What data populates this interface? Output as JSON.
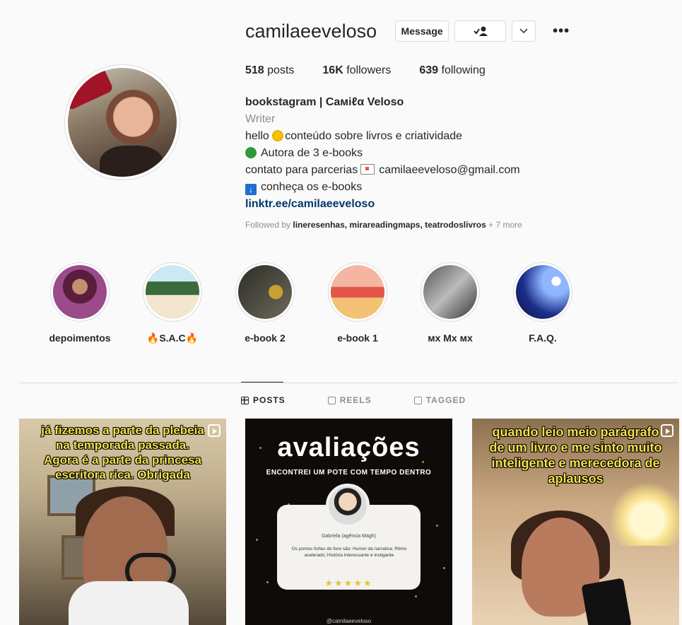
{
  "profile": {
    "username": "camilaeeveloso",
    "actions": {
      "message": "Message",
      "follow_icon": "person-check-icon",
      "chevron_icon": "chevron-down-icon",
      "more": "•••"
    },
    "stats": {
      "posts_count": "518",
      "posts_label": "posts",
      "followers_count": "16K",
      "followers_label": "followers",
      "following_count": "639",
      "following_label": "following"
    },
    "bio": {
      "name": "bookstagram | Cамiℓα Veloso",
      "category": "Writer",
      "line1": "hello ",
      "line1b": "conteúdo sobre livros e criatividade",
      "line2": "Autora de 3 e-books",
      "line3a": "contato para parcerias",
      "line3b": "camilaeeveloso@gmail.com",
      "line4": "conheça os e-books",
      "link": "linktr.ee/camilaeeveloso"
    },
    "followed_by": {
      "prefix": "Followed by ",
      "names": "lineresenhas, mirareadingmaps, teatrodoslivros",
      "suffix": " + 7 more"
    }
  },
  "highlights": [
    {
      "label": "depoimentos"
    },
    {
      "label": "🔥S.A.C🔥"
    },
    {
      "label": "e-book 2"
    },
    {
      "label": "e-book 1"
    },
    {
      "label": "ᴍx Mx ᴍx"
    },
    {
      "label": "F.A.Q."
    }
  ],
  "tabs": [
    {
      "label": "POSTS",
      "icon": "grid-icon"
    },
    {
      "label": "REELS",
      "icon": "reels-icon"
    },
    {
      "label": "TAGGED",
      "icon": "tagged-icon"
    }
  ],
  "posts": [
    {
      "type": "reel",
      "caption": "já fizemos a parte da plebeia na temporada passada. Agora é a parte da princesa escritora rica. Obrigada"
    },
    {
      "type": "image",
      "title": "avaliações",
      "subtitle": "ENCONTREI UM POTE COM TEMPO DENTRO",
      "reviewer": "Gabriela (agência Magh)",
      "review": "Os pontos fortes do livro são: Humor da narrativa; Ritmo acelerado; História interessante e instigante",
      "stars": "★★★★★",
      "handle": "@camilaeeveloso"
    },
    {
      "type": "reel",
      "caption": "quando leio meio parágrafo de um livro e me sinto muito inteligente e merecedora de aplausos"
    }
  ]
}
